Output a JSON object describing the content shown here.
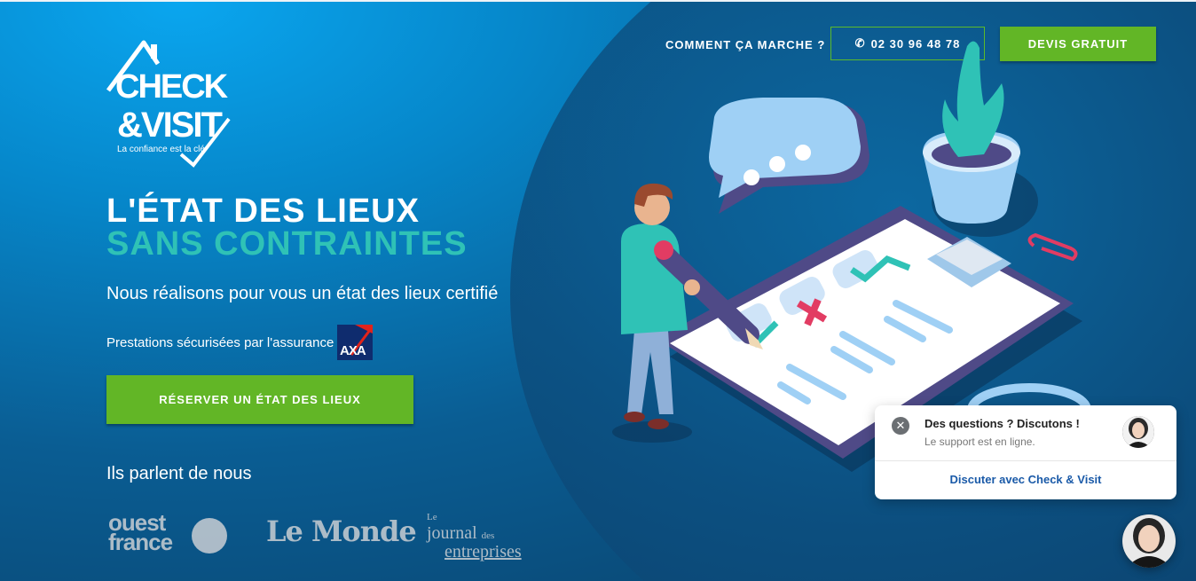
{
  "logo": {
    "line1": "CHECK",
    "line2": "&VISIT",
    "tagline": "La confiance est la clé"
  },
  "nav": {
    "how_it_works": "COMMENT ÇA MARCHE ?",
    "phone": "02 30 96 48 78",
    "quote": "DEVIS GRATUIT"
  },
  "hero": {
    "title_line1": "L'ÉTAT DES LIEUX",
    "title_line2": "SANS CONTRAINTES",
    "subtitle": "Nous réalisons pour vous un état des lieux certifié",
    "insurance_text": "Prestations sécurisées par l'assurance",
    "insurance_brand": "AXA",
    "cta": "RÉSERVER UN ÉTAT DES LIEUX"
  },
  "press": {
    "title": "Ils parlent de nous",
    "logos": [
      "ouest france",
      "Le Monde",
      "Le journal des entreprises"
    ]
  },
  "chat": {
    "title": "Des questions ? Discutons !",
    "status": "Le support est en ligne.",
    "link": "Discuter avec Check & Visit"
  },
  "colors": {
    "green": "#62b626",
    "teal": "#2fc2b6",
    "blue_dark": "#0b3c63",
    "blue_light": "#0aa6ef"
  },
  "icons": [
    "phone-icon",
    "close-icon",
    "house-roof-icon",
    "checkmark-icon"
  ]
}
